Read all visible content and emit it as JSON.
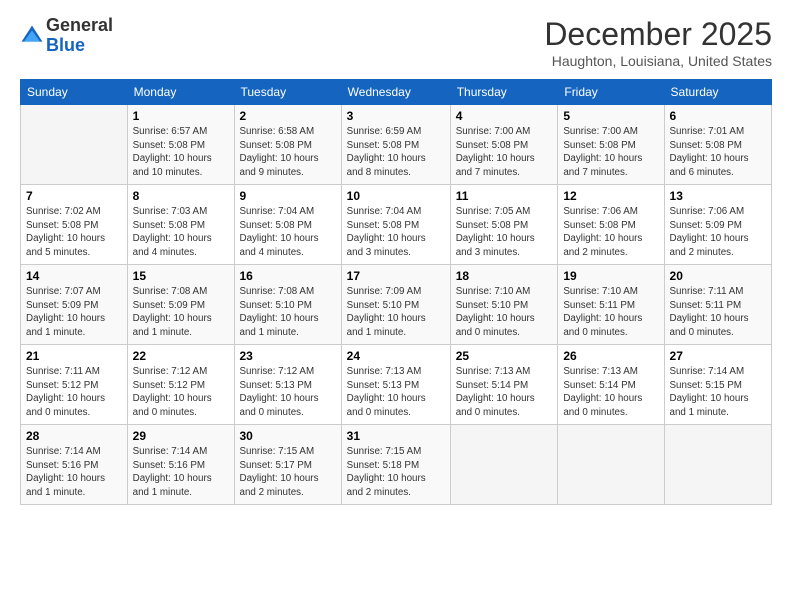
{
  "header": {
    "logo": {
      "general": "General",
      "blue": "Blue"
    },
    "title": "December 2025",
    "location": "Haughton, Louisiana, United States"
  },
  "calendar": {
    "days": [
      "Sunday",
      "Monday",
      "Tuesday",
      "Wednesday",
      "Thursday",
      "Friday",
      "Saturday"
    ],
    "weeks": [
      [
        {
          "num": "",
          "info": ""
        },
        {
          "num": "1",
          "info": "Sunrise: 6:57 AM\nSunset: 5:08 PM\nDaylight: 10 hours\nand 10 minutes."
        },
        {
          "num": "2",
          "info": "Sunrise: 6:58 AM\nSunset: 5:08 PM\nDaylight: 10 hours\nand 9 minutes."
        },
        {
          "num": "3",
          "info": "Sunrise: 6:59 AM\nSunset: 5:08 PM\nDaylight: 10 hours\nand 8 minutes."
        },
        {
          "num": "4",
          "info": "Sunrise: 7:00 AM\nSunset: 5:08 PM\nDaylight: 10 hours\nand 7 minutes."
        },
        {
          "num": "5",
          "info": "Sunrise: 7:00 AM\nSunset: 5:08 PM\nDaylight: 10 hours\nand 7 minutes."
        },
        {
          "num": "6",
          "info": "Sunrise: 7:01 AM\nSunset: 5:08 PM\nDaylight: 10 hours\nand 6 minutes."
        }
      ],
      [
        {
          "num": "7",
          "info": "Sunrise: 7:02 AM\nSunset: 5:08 PM\nDaylight: 10 hours\nand 5 minutes."
        },
        {
          "num": "8",
          "info": "Sunrise: 7:03 AM\nSunset: 5:08 PM\nDaylight: 10 hours\nand 4 minutes."
        },
        {
          "num": "9",
          "info": "Sunrise: 7:04 AM\nSunset: 5:08 PM\nDaylight: 10 hours\nand 4 minutes."
        },
        {
          "num": "10",
          "info": "Sunrise: 7:04 AM\nSunset: 5:08 PM\nDaylight: 10 hours\nand 3 minutes."
        },
        {
          "num": "11",
          "info": "Sunrise: 7:05 AM\nSunset: 5:08 PM\nDaylight: 10 hours\nand 3 minutes."
        },
        {
          "num": "12",
          "info": "Sunrise: 7:06 AM\nSunset: 5:08 PM\nDaylight: 10 hours\nand 2 minutes."
        },
        {
          "num": "13",
          "info": "Sunrise: 7:06 AM\nSunset: 5:09 PM\nDaylight: 10 hours\nand 2 minutes."
        }
      ],
      [
        {
          "num": "14",
          "info": "Sunrise: 7:07 AM\nSunset: 5:09 PM\nDaylight: 10 hours\nand 1 minute."
        },
        {
          "num": "15",
          "info": "Sunrise: 7:08 AM\nSunset: 5:09 PM\nDaylight: 10 hours\nand 1 minute."
        },
        {
          "num": "16",
          "info": "Sunrise: 7:08 AM\nSunset: 5:10 PM\nDaylight: 10 hours\nand 1 minute."
        },
        {
          "num": "17",
          "info": "Sunrise: 7:09 AM\nSunset: 5:10 PM\nDaylight: 10 hours\nand 1 minute."
        },
        {
          "num": "18",
          "info": "Sunrise: 7:10 AM\nSunset: 5:10 PM\nDaylight: 10 hours\nand 0 minutes."
        },
        {
          "num": "19",
          "info": "Sunrise: 7:10 AM\nSunset: 5:11 PM\nDaylight: 10 hours\nand 0 minutes."
        },
        {
          "num": "20",
          "info": "Sunrise: 7:11 AM\nSunset: 5:11 PM\nDaylight: 10 hours\nand 0 minutes."
        }
      ],
      [
        {
          "num": "21",
          "info": "Sunrise: 7:11 AM\nSunset: 5:12 PM\nDaylight: 10 hours\nand 0 minutes."
        },
        {
          "num": "22",
          "info": "Sunrise: 7:12 AM\nSunset: 5:12 PM\nDaylight: 10 hours\nand 0 minutes."
        },
        {
          "num": "23",
          "info": "Sunrise: 7:12 AM\nSunset: 5:13 PM\nDaylight: 10 hours\nand 0 minutes."
        },
        {
          "num": "24",
          "info": "Sunrise: 7:13 AM\nSunset: 5:13 PM\nDaylight: 10 hours\nand 0 minutes."
        },
        {
          "num": "25",
          "info": "Sunrise: 7:13 AM\nSunset: 5:14 PM\nDaylight: 10 hours\nand 0 minutes."
        },
        {
          "num": "26",
          "info": "Sunrise: 7:13 AM\nSunset: 5:14 PM\nDaylight: 10 hours\nand 0 minutes."
        },
        {
          "num": "27",
          "info": "Sunrise: 7:14 AM\nSunset: 5:15 PM\nDaylight: 10 hours\nand 1 minute."
        }
      ],
      [
        {
          "num": "28",
          "info": "Sunrise: 7:14 AM\nSunset: 5:16 PM\nDaylight: 10 hours\nand 1 minute."
        },
        {
          "num": "29",
          "info": "Sunrise: 7:14 AM\nSunset: 5:16 PM\nDaylight: 10 hours\nand 1 minute."
        },
        {
          "num": "30",
          "info": "Sunrise: 7:15 AM\nSunset: 5:17 PM\nDaylight: 10 hours\nand 2 minutes."
        },
        {
          "num": "31",
          "info": "Sunrise: 7:15 AM\nSunset: 5:18 PM\nDaylight: 10 hours\nand 2 minutes."
        },
        {
          "num": "",
          "info": ""
        },
        {
          "num": "",
          "info": ""
        },
        {
          "num": "",
          "info": ""
        }
      ]
    ]
  }
}
